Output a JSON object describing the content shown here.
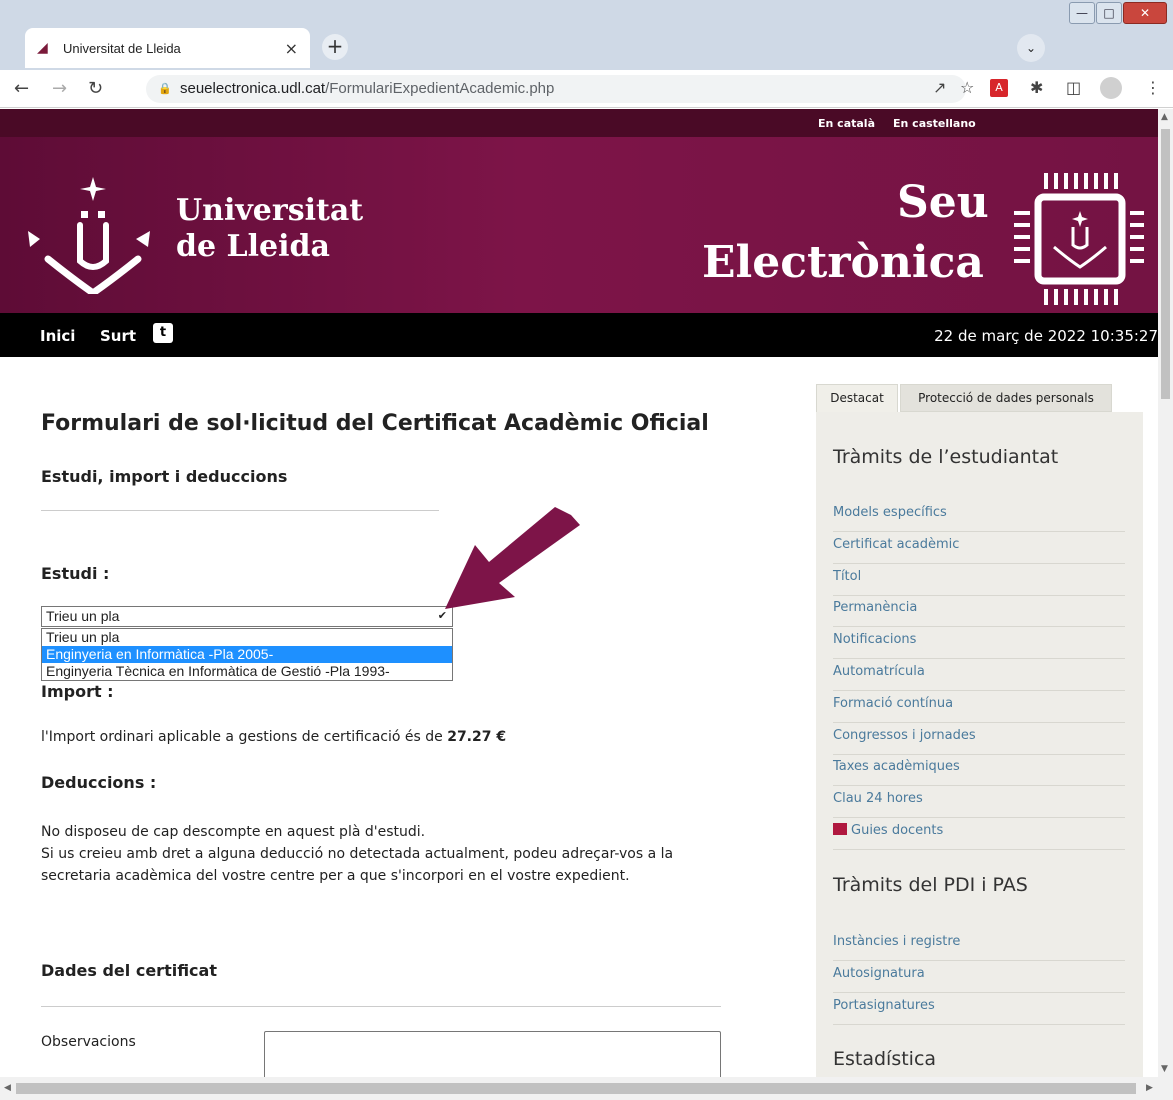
{
  "browser": {
    "tab_title": "Universitat de Lleida",
    "tab_close": "×",
    "new_tab": "+",
    "url_domain": "seuelectronica.udl.cat",
    "url_path": "/FormulariExpedientAcademic.php"
  },
  "lang": {
    "catala": "En català",
    "castellano": "En castellano"
  },
  "banner": {
    "uni_line1": "Universitat",
    "uni_line2": "de Lleida",
    "seu_line1": "Seu",
    "seu_line2": "Electrònica"
  },
  "nav": {
    "inici": "Inici",
    "surt": "Surt",
    "datetime": "22 de març de 2022 10:35:27"
  },
  "form": {
    "title": "Formulari de sol·licitud del Certificat Acadèmic Oficial",
    "section1": "Estudi, import i deduccions",
    "estudi_label": "Estudi :",
    "select_value": "Trieu un pla",
    "options": [
      "Trieu un pla",
      "Enginyeria en Informàtica -Pla 2005-",
      "Enginyeria Tècnica en Informàtica de Gestió -Pla 1993-"
    ],
    "selected_index": 1,
    "import_label": "Import :",
    "import_text": "l'Import ordinari aplicable a gestions de certificació és de",
    "import_amount": "27.27 €",
    "deduccions_label": "Deduccions :",
    "ded_line1": "No disposeu de cap descompte en aquest plà d'estudi.",
    "ded_line2": "Si us creieu amb dret a alguna deducció no detectada actualment, podeu adreçar-vos a la",
    "ded_line3": "secretaria acadèmica del vostre centre per a que s'incorpori en el vostre expedient.",
    "section2": "Dades del certificat",
    "observacions_label": "Observacions"
  },
  "sidebar": {
    "tab1": "Destacat",
    "tab2": "Protecció de dades personals",
    "heading1": "Tràmits de l’estudiantat",
    "items1": [
      "Models específics",
      "Certificat acadèmic",
      "Títol",
      "Permanència",
      "Notificacions",
      "Automatrícula",
      "Formació contínua",
      "Congressos i jornades",
      "Taxes acadèmiques",
      "Clau 24 hores",
      "Guies docents"
    ],
    "heading2": "Tràmits del PDI i PAS",
    "items2": [
      "Instàncies i registre",
      "Autosignatura",
      "Portasignatures"
    ],
    "heading3": "Estadística"
  },
  "colors": {
    "brand": "#7d1448",
    "brand_dark": "#4a0a26",
    "link": "#4a7a9c",
    "select_highlight": "#1e90ff"
  }
}
